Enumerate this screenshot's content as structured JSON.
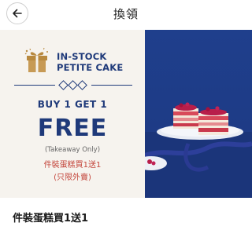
{
  "header": {
    "title": "換領",
    "back_icon": "arrow-left-icon"
  },
  "banner": {
    "gift_icon": "gift-box-icon",
    "headline_line1": "IN-STOCK",
    "headline_line2": "PETITE CAKE",
    "offer_line": "BUY 1 GET 1",
    "free_text": "FREE",
    "note": "(Takeaway Only)",
    "chinese_offer": "件裝蛋糕買1送1",
    "chinese_note": "(只限外賣)",
    "colors": {
      "navy": "#1f3a7a",
      "cream": "#f6f3ee",
      "red_text": "#c4473d",
      "photo_blue": "#1e3b86"
    }
  },
  "item": {
    "title": "件裝蛋糕買1送1"
  }
}
